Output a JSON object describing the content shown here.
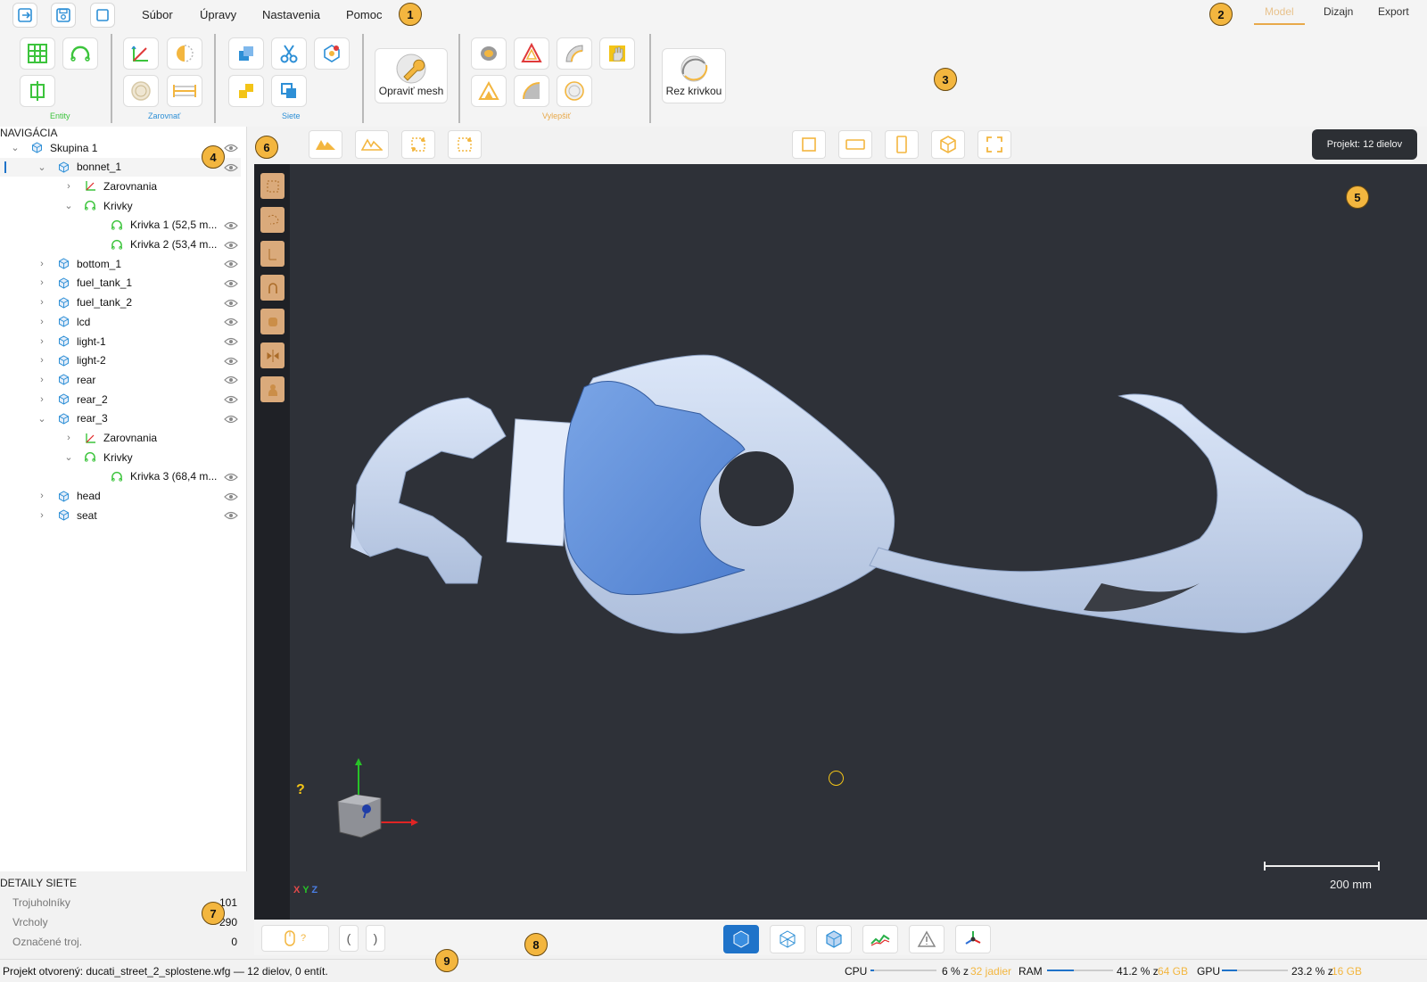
{
  "menu": {
    "items": [
      "Súbor",
      "Úpravy",
      "Nastavenia",
      "Pomoc"
    ],
    "mode_tabs": [
      "Model",
      "Dizajn",
      "Export"
    ],
    "active_mode": "Model"
  },
  "badges": [
    "1",
    "2",
    "3",
    "4",
    "5",
    "6",
    "7",
    "8",
    "9"
  ],
  "ribbon": {
    "groups": [
      {
        "label": "Entity",
        "color": "#3cc43c"
      },
      {
        "label": "Zarovnať",
        "color": "#2d8fd6"
      },
      {
        "label": "Siete",
        "color": "#2d8fd6"
      },
      {
        "label": "Vylepšiť",
        "color": "#e8a94a"
      }
    ],
    "repair_label": "Opraviť mesh",
    "curve_cut_label": "Rez krivkou"
  },
  "nav": {
    "title": "NAVIGÁCIA",
    "tree": [
      {
        "label": "Skupina 1",
        "icon": "cube-icon",
        "chevron": "down"
      },
      {
        "label": "bonnet_1",
        "icon": "cube-icon",
        "chevron": "down"
      },
      {
        "label": "Zarovnania",
        "icon": "axes-icon",
        "chevron": "right"
      },
      {
        "label": "Krivky",
        "icon": "curve-icon",
        "chevron": "down"
      },
      {
        "label": "Krivka 1  (52,5 m...",
        "icon": "curve-icon",
        "chevron": ""
      },
      {
        "label": "Krivka 2  (53,4 m...",
        "icon": "curve-icon",
        "chevron": ""
      },
      {
        "label": "bottom_1",
        "icon": "cube-icon",
        "chevron": "right"
      },
      {
        "label": "fuel_tank_1",
        "icon": "cube-icon",
        "chevron": "right"
      },
      {
        "label": "fuel_tank_2",
        "icon": "cube-icon",
        "chevron": "right"
      },
      {
        "label": "lcd",
        "icon": "cube-icon",
        "chevron": "right"
      },
      {
        "label": "light-1",
        "icon": "cube-icon",
        "chevron": "right"
      },
      {
        "label": "light-2",
        "icon": "cube-icon",
        "chevron": "right"
      },
      {
        "label": "rear",
        "icon": "cube-icon",
        "chevron": "right"
      },
      {
        "label": "rear_2",
        "icon": "cube-icon",
        "chevron": "right"
      },
      {
        "label": "rear_3",
        "icon": "cube-icon",
        "chevron": "down"
      },
      {
        "label": "Zarovnania",
        "icon": "axes-icon",
        "chevron": "right"
      },
      {
        "label": "Krivky",
        "icon": "curve-icon",
        "chevron": "down"
      },
      {
        "label": "Krivka 3  (68,4 m...",
        "icon": "curve-icon",
        "chevron": ""
      },
      {
        "label": "head",
        "icon": "cube-icon",
        "chevron": "right"
      },
      {
        "label": "seat",
        "icon": "cube-icon",
        "chevron": "right"
      }
    ]
  },
  "project_pill": "Projekt: 12 dielov",
  "viewport": {
    "help_mark": "?",
    "axis_legend": {
      "x": "X",
      "y": "Y",
      "z": "Z"
    },
    "scale_label": "200 mm"
  },
  "details": {
    "title": "DETAILY SIETE",
    "rows": [
      {
        "label": "Trojuholníky",
        "value": "101"
      },
      {
        "label": "Vrcholy",
        "value": "290"
      },
      {
        "label": "Označené troj.",
        "value": "0"
      }
    ]
  },
  "bottom": {
    "mouse_hint": "?",
    "bracket_left": "(",
    "bracket_right": ")"
  },
  "status": {
    "message": "Projekt otvorený: ducati_street_2_splostene.wfg — 12 dielov, 0 entít.",
    "cpu": {
      "label": "CPU",
      "value": "6 % z",
      "total": "32 jadier",
      "fraction": 0.06
    },
    "ram": {
      "label": "RAM",
      "value": "41.2 % z",
      "total": "64 GB",
      "fraction": 0.412
    },
    "gpu": {
      "label": "GPU",
      "value": "23.2 % z",
      "total": "16 GB",
      "fraction": 0.232
    }
  },
  "colors": {
    "accent": "#f3b63f",
    "viewport_bg": "#2e3138",
    "model_light": "#c9d8f2",
    "model_selected": "#6f9be0"
  }
}
